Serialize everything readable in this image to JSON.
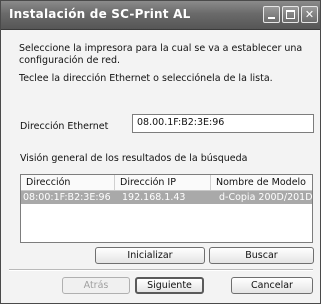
{
  "window": {
    "title": "Instalación de SC-Print AL",
    "controls": {
      "minimize_icon": "minimize-icon",
      "maximize_icon": "maximize-icon",
      "close_label": "✕"
    }
  },
  "instructions": {
    "line1": "Seleccione la impresora para la cual se va a establecer una",
    "line2": "configuración de red.",
    "line3": "Teclee la dirección Ethernet o selecciónela de la lista."
  },
  "ethernet": {
    "label": "Dirección Ethernet",
    "value": "08.00.1F:B2:3E:96"
  },
  "results": {
    "heading": "Visión general de los resultados de la búsqueda",
    "columns": [
      "Dirección Ethernet",
      "Dirección IP",
      "Nombre de Modelo"
    ],
    "rows": [
      {
        "ethernet": "08:00:1F:B2:3E:96",
        "ip": "192.168.1.43",
        "model": "d-Copia 200D/201D",
        "selected": true
      }
    ]
  },
  "actions": {
    "initialize": "Inicializar",
    "search": "Buscar",
    "back": "Atrás",
    "next": "Siguiente",
    "cancel": "Cancelar"
  },
  "colors": {
    "titlebar": "#6a6a6a",
    "selection": "#a9a9a9"
  }
}
